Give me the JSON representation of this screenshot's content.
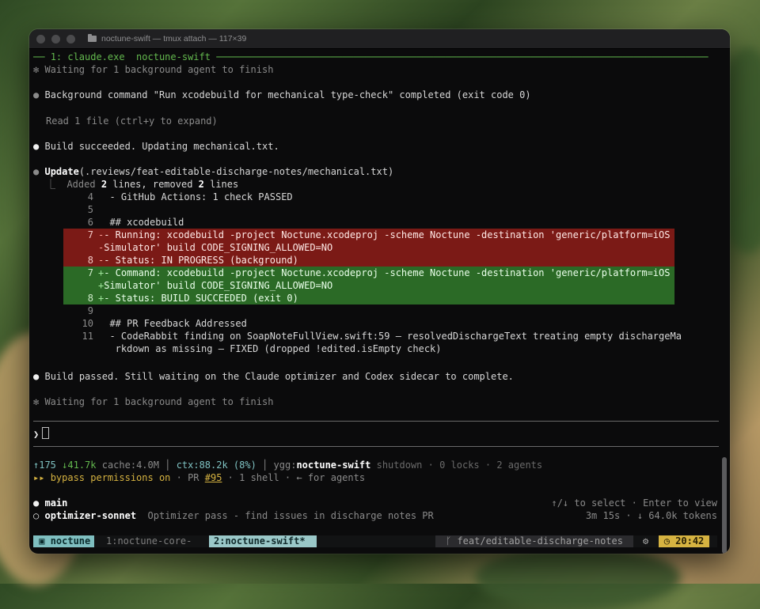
{
  "window": {
    "title": "noctune-swift — tmux attach — 117×39"
  },
  "pane": {
    "header": "1: claude.exe  noctune-swift"
  },
  "transcript": {
    "waiting1": "✻ Waiting for 1 background agent to finish",
    "bg_command": "Background command \"Run xcodebuild for mechanical type-check\" completed (exit code 0)",
    "read_file": "Read 1 file (ctrl+y to expand)",
    "build_succeeded": "Build succeeded. Updating mechanical.txt.",
    "update_title": "Update",
    "update_path": "(.reviews/feat-editable-discharge-notes/mechanical.txt)",
    "added_summary_prefix": "⎿  Added ",
    "added_count": "2",
    "added_mid": " lines, removed ",
    "removed_count": "2",
    "added_suffix": " lines",
    "build_passed": "Build passed. Still waiting on the Claude optimizer and Codex sidecar to complete.",
    "waiting2": "✻ Waiting for 1 background agent to finish",
    "bullet": "●"
  },
  "diff": [
    {
      "n": "4",
      "sign": " ",
      "text": " - GitHub Actions: 1 check PASSED",
      "type": "ctx"
    },
    {
      "n": "5",
      "sign": " ",
      "text": "",
      "type": "ctx"
    },
    {
      "n": "6",
      "sign": " ",
      "text": " ## xcodebuild",
      "type": "ctx"
    },
    {
      "n": "7",
      "sign": "-",
      "text": "- Running: xcodebuild -project Noctune.xcodeproj -scheme Noctune -destination 'generic/platform=iOS",
      "type": "del"
    },
    {
      "n": "",
      "sign": "-",
      "text": "Simulator' build CODE_SIGNING_ALLOWED=NO",
      "type": "del"
    },
    {
      "n": "8",
      "sign": "-",
      "text": "- Status: IN PROGRESS (background)",
      "type": "del"
    },
    {
      "n": "7",
      "sign": "+",
      "text": "- Command: xcodebuild -project Noctune.xcodeproj -scheme Noctune -destination 'generic/platform=iOS",
      "type": "add"
    },
    {
      "n": "",
      "sign": "+",
      "text": "Simulator' build CODE_SIGNING_ALLOWED=NO",
      "type": "add"
    },
    {
      "n": "8",
      "sign": "+",
      "text": "- Status: BUILD SUCCEEDED (exit 0)",
      "type": "add"
    },
    {
      "n": "9",
      "sign": " ",
      "text": "",
      "type": "ctx"
    },
    {
      "n": "10",
      "sign": " ",
      "text": " ## PR Feedback Addressed",
      "type": "ctx"
    },
    {
      "n": "11",
      "sign": " ",
      "text": " - CodeRabbit finding on SoapNoteFullView.swift:59 — resolvedDischargeText treating empty dischargeMa",
      "type": "ctx"
    },
    {
      "n": "",
      "sign": " ",
      "text": "  rkdown as missing — FIXED (dropped !edited.isEmpty check)",
      "type": "ctx"
    }
  ],
  "prompt": {
    "symbol": "❯"
  },
  "stats": {
    "up": "↑175",
    "down": "↓41.7k",
    "cache": "cache:4.0M",
    "ctx": "ctx:88.2k (8%)",
    "ygg_label": "ygg:",
    "ygg_name": "noctune-swift",
    "ygg_rest": "shutdown · 0 locks · 2 agents"
  },
  "mode": {
    "arrows": "▸▸",
    "bypass": "bypass permissions on",
    "pr_label": " · PR ",
    "pr_number": "#95",
    "shells": " · 1 shell · ← for agents"
  },
  "agents": {
    "main_bullet": "●",
    "main_name": "main",
    "hint": "↑/↓ to select · Enter to view",
    "opt_bullet": "○",
    "opt_name": "optimizer-sonnet",
    "opt_desc": "Optimizer pass - find issues in discharge notes PR",
    "opt_stats": "3m 15s · ↓ 64.0k tokens"
  },
  "tmux": {
    "session": "noctune",
    "tab1": "1:noctune-core-",
    "tab2": "2:noctune-swift*",
    "branch": "feat/editable-discharge-notes",
    "time": "20:42"
  },
  "colors": {
    "accent_green": "#63b84e",
    "diff_del_bg": "#7b1a16",
    "diff_add_bg": "#2b6a26",
    "tmux_teal": "#7fbfc0",
    "clock_yellow": "#d6b341"
  }
}
